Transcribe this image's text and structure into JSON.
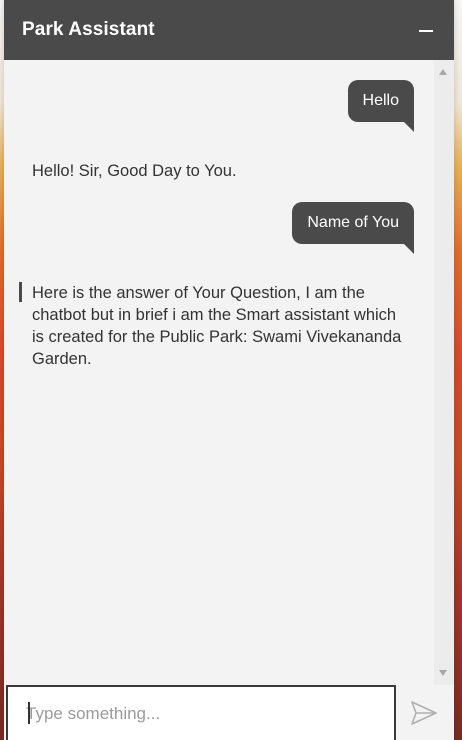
{
  "header": {
    "title": "Park Assistant",
    "minimize_icon": "minimize-icon"
  },
  "messages": [
    {
      "sender": "user",
      "text": "Hello"
    },
    {
      "sender": "bot",
      "text": "Hello! Sir, Good Day to You."
    },
    {
      "sender": "user",
      "text": "Name of You"
    },
    {
      "sender": "bot",
      "text": "Here is the answer of Your Question, I am the chatbot but in brief i am the Smart assistant which is created for the Public Park: Swami Vivekananda Garden."
    }
  ],
  "composer": {
    "placeholder": "Type something...",
    "value": "",
    "send_icon": "send-icon"
  },
  "colors": {
    "header_bg": "#4a4a4a",
    "user_bubble_bg": "#4a4a4a",
    "panel_bg": "#f3f3f3"
  }
}
